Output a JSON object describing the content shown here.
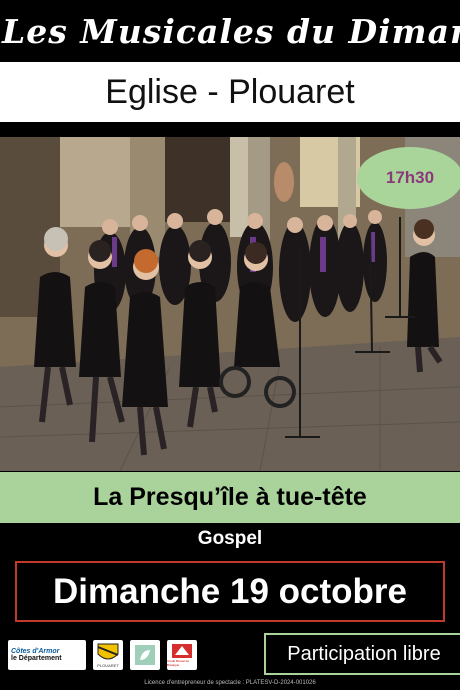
{
  "poster": {
    "series_title": "Les Musicales du Dimanche",
    "venue": "Eglise - Plouaret",
    "time": "17h30",
    "group_name": "La Presqu’île à tue-tête",
    "genre": "Gospel",
    "date": "Dimanche 19 octobre",
    "admission": "Participation libre",
    "license": "Licence d'entrepreneur de spectacle : PLATESV-D-2024-001026"
  },
  "logos": {
    "cotes_line1": "Côtes d'Armor",
    "cotes_line2": "le Département",
    "plouaret": "PLOUARET",
    "bank": "Crédit Mutuel de Bretagne"
  },
  "colors": {
    "background": "#000000",
    "accent_green": "#a9d39a",
    "time_text": "#8a3a7a",
    "date_border": "#c0392b"
  }
}
